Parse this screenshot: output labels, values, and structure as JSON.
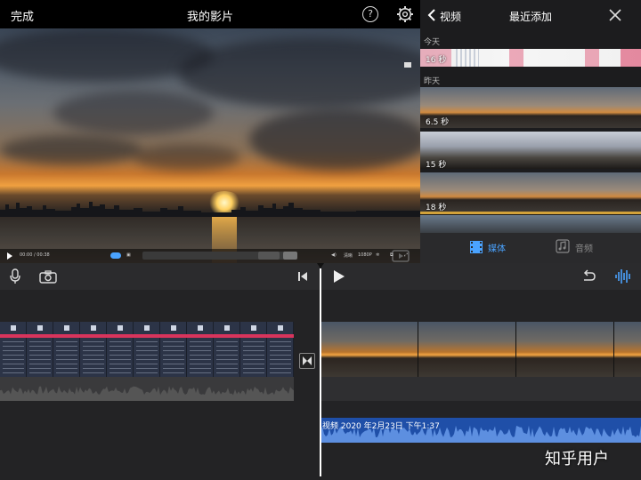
{
  "topbar": {
    "done_label": "完成",
    "title": "我的影片",
    "help_label": "?"
  },
  "preview": {
    "controls": {
      "time": "00:00 / 00:38",
      "quality_label": "清晰",
      "quality_value": "1080P"
    }
  },
  "browser": {
    "back_label": "视频",
    "title": "最近添加",
    "today_label": "今天",
    "today_duration": "16 秒",
    "yesterday_label": "昨天",
    "clips": [
      {
        "duration": "6.5 秒"
      },
      {
        "duration": "15 秒"
      },
      {
        "duration": "18 秒"
      }
    ],
    "tabs": [
      {
        "label": "媒体",
        "selected": true
      },
      {
        "label": "音频",
        "selected": false
      }
    ]
  },
  "timeline": {
    "audio_clip_label": "视频 2020 年2月23日 下午1:37"
  },
  "watermark": "知乎用户",
  "colors": {
    "accent": "#4aa3ff",
    "audio_clip": "#1f4fa8",
    "clip_highlight": "#d8345c",
    "browser_bg": "#1c1c1e",
    "timeline_bg": "#2b2b2d"
  }
}
